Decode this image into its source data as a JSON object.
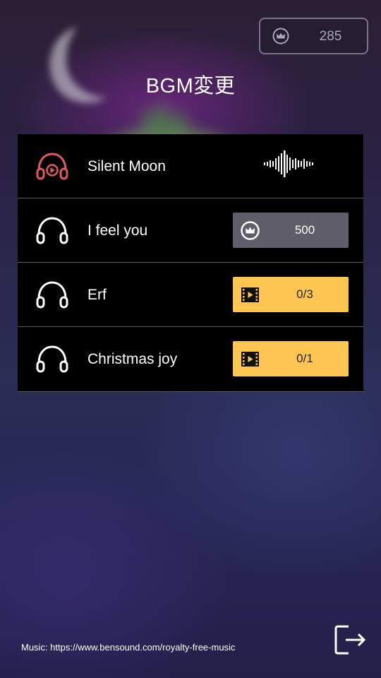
{
  "header": {
    "coin_balance": "285",
    "title": "BGM変更"
  },
  "tracks": [
    {
      "name": "Silent Moon",
      "state": "playing",
      "icon": "headphone-play-icon",
      "indicator": "waveform-icon"
    },
    {
      "name": "I feel you",
      "state": "locked-coin",
      "icon": "headphone-icon",
      "unlock_label": "500",
      "unlock_icon": "crown-coin-icon"
    },
    {
      "name": "Erf",
      "state": "locked-video",
      "icon": "headphone-icon",
      "unlock_label": "0/3",
      "unlock_icon": "film-icon"
    },
    {
      "name": "Christmas joy",
      "state": "locked-video",
      "icon": "headphone-icon",
      "unlock_label": "0/1",
      "unlock_icon": "film-icon"
    }
  ],
  "footer": {
    "credit": "Music: https://www.bensound.com/royalty-free-music",
    "exit_icon": "exit-icon"
  },
  "colors": {
    "active_track": "#e0595e",
    "video_button": "#fdc650",
    "coin_button": "#5e5d69",
    "list_background": "#000000"
  }
}
